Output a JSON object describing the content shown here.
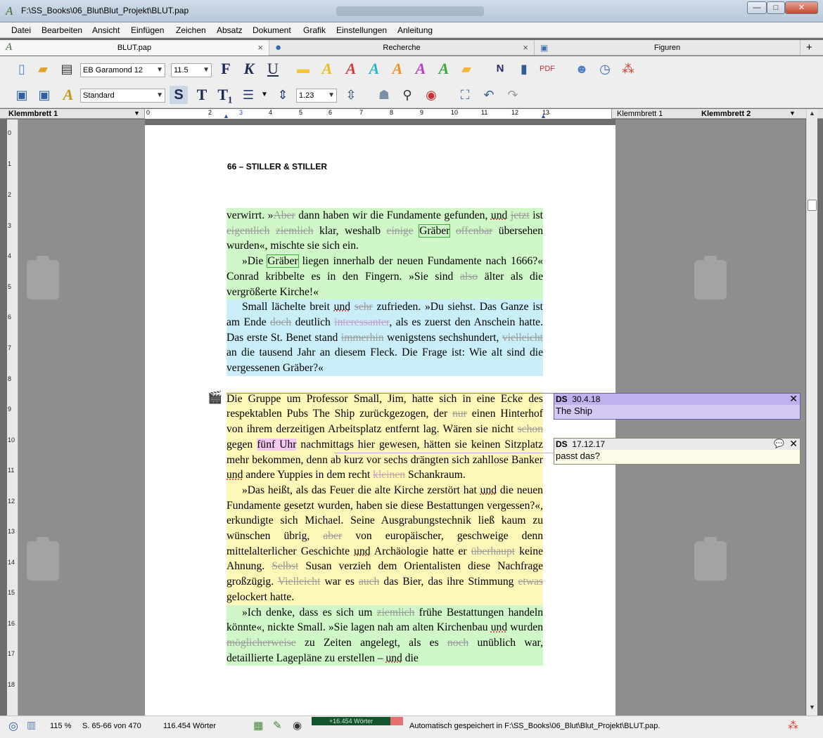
{
  "window": {
    "title": "F:\\SS_Books\\06_Blut\\Blut_Projekt\\BLUT.pap",
    "min": "—",
    "max": "□",
    "close": "✕"
  },
  "menu": [
    "Datei",
    "Bearbeiten",
    "Ansicht",
    "Einfügen",
    "Zeichen",
    "Absatz",
    "Dokument",
    "Grafik",
    "Einstellungen",
    "Anleitung"
  ],
  "tabs": [
    {
      "label": "BLUT.pap",
      "close": "×"
    },
    {
      "label": "Recherche",
      "close": "×"
    },
    {
      "label": "Figuren"
    }
  ],
  "tab_add": "+",
  "toolbar": {
    "font": "EB Garamond 12",
    "size": "11.5",
    "style": "Standard",
    "line_spacing": "1.23",
    "bold": "F",
    "italic": "K",
    "underline": "U",
    "bold_s": "S",
    "t1": "T",
    "t2": "T₁"
  },
  "clipboards": {
    "left": "Klemmbrett 1",
    "right1": "Klemmbrett 1",
    "right2": "Klemmbrett 2",
    "dropdown": "▼"
  },
  "ruler_numbers": [
    "0",
    "1",
    "2",
    "3",
    "4",
    "5",
    "6",
    "7",
    "8",
    "9",
    "10",
    "11",
    "12",
    "13",
    "14",
    "15",
    "16",
    "17",
    "18"
  ],
  "page": {
    "header": "66 – STILLER & STILLER",
    "p1": {
      "a": "verwirrt. »",
      "d1": "Aber",
      "b": " dann haben wir die Fundamente gefunden, ",
      "s1": "und",
      "c": " ",
      "d2": "jetzt",
      "e": " ist ",
      "d3": "eigentlich",
      "f": " ",
      "d4": "ziemlich",
      "g": " klar, weshalb ",
      "d5": "einige",
      "h": " ",
      "box": "Gräber",
      "i": " ",
      "d6": "offenbar",
      "j": " übersehen wurden«, mischte sie sich ein."
    },
    "p2": {
      "a": "»Die ",
      "box": "Gräber",
      "b": " liegen innerhalb der neuen Fundamente nach 1666?« Conrad kribbelte es in den Fingern. »Sie sind ",
      "d1": "also",
      "c": " älter als die vergrößerte Kirche!«"
    },
    "p3": {
      "a": "Small lächelte breit ",
      "s1": "und",
      "b": " ",
      "d1": "sehr",
      "c": " zufrieden. »Du siehst. Das Ganze ist am Ende ",
      "d2": "doch",
      "d": " deutlich ",
      "d3": "interessanter",
      "e": ", als es zuerst den Anschein hatte. Das erste St. Benet stand ",
      "d4": "immerhin",
      "f": " wenigstens sechshundert, ",
      "d5": "vielleicht",
      "g": " an die tausend Jahr an diesem Fleck. Die Frage ist: Wie alt sind die vergessenen Gräber?«"
    },
    "p4": {
      "a": "Die Gruppe um Professor Small, Jim, hatte sich in eine Ecke des respektablen Pubs The Ship zurückgezogen, der ",
      "d1": "nur",
      "b": " einen Hinterhof von ihrem derzeitigen Arbeitsplatz entfernt lag. Wären sie nicht ",
      "d2": "schon",
      "c": " gegen ",
      "pink": "fünf Uhr",
      "d": " nachmittags hier gewesen, hätten sie keinen Sitzplatz mehr bekommen, denn ab kurz vor sechs drängten sich zahllose Banker ",
      "s1": "und",
      "e": " andere Yuppies in dem recht ",
      "d3": "kleinen",
      "f": " Schankraum."
    },
    "p5": {
      "a": "»Das heißt, als das Feuer die alte Kirche zerstört hat ",
      "s1": "und",
      "b": " die neuen Fundamente gesetzt wurden, haben sie diese Bestattungen vergessen?«, erkundigte sich Michael. Seine Ausgrabungstechnik ließ kaum zu wünschen übrig, ",
      "d1": "aber",
      "c": " von europäischer, geschweige denn mittelalterlicher Geschichte ",
      "s2": "und",
      "d": " Archäologie hatte er ",
      "d2": "überhaupt",
      "e": " keine Ahnung. ",
      "d3": "Selbst",
      "f": " Susan verzieh dem Orientalisten diese Nachfrage großzügig. ",
      "d4": "Vielleicht",
      "g": " war es ",
      "d5": "auch",
      "h": " das Bier, das ihre Stimmung ",
      "d6": "etwas",
      "i": " gelockert hatte."
    },
    "p6": {
      "a": "»Ich denke, dass es sich um ",
      "d1": "ziemlich",
      "b": " frühe Bestattungen handeln könnte«, nickte Small. »Sie lagen nah am alten Kirchenbau ",
      "s1": "und",
      "c": " wurden ",
      "d2": "möglicherweise",
      "d": " zu Zeiten angelegt, als es ",
      "d3": "noch",
      "e": " unüblich war, detaillierte Lagepläne zu erstellen – ",
      "s2": "und",
      "f": " die"
    }
  },
  "comments": [
    {
      "author": "DS",
      "date": "30.4.18",
      "text": "The Ship",
      "close": "✕"
    },
    {
      "author": "DS",
      "date": "17.12.17",
      "text": "passt das?",
      "close": "✕"
    }
  ],
  "status": {
    "zoom": "115 %",
    "pages": "S. 65-66 von 470",
    "words": "116.454 Wörter",
    "progress_label": "+16.454 Wörter",
    "progress_fraction": 0.86,
    "autosave": "Automatisch gespeichert in F:\\SS_Books\\06_Blut\\Blut_Projekt\\BLUT.pap."
  },
  "colors": {
    "highlight_yellow": "#fdf7b8",
    "highlight_green": "#cff7c8",
    "highlight_blue": "#c9eef8",
    "comment_purple": "#d4c8f4"
  }
}
